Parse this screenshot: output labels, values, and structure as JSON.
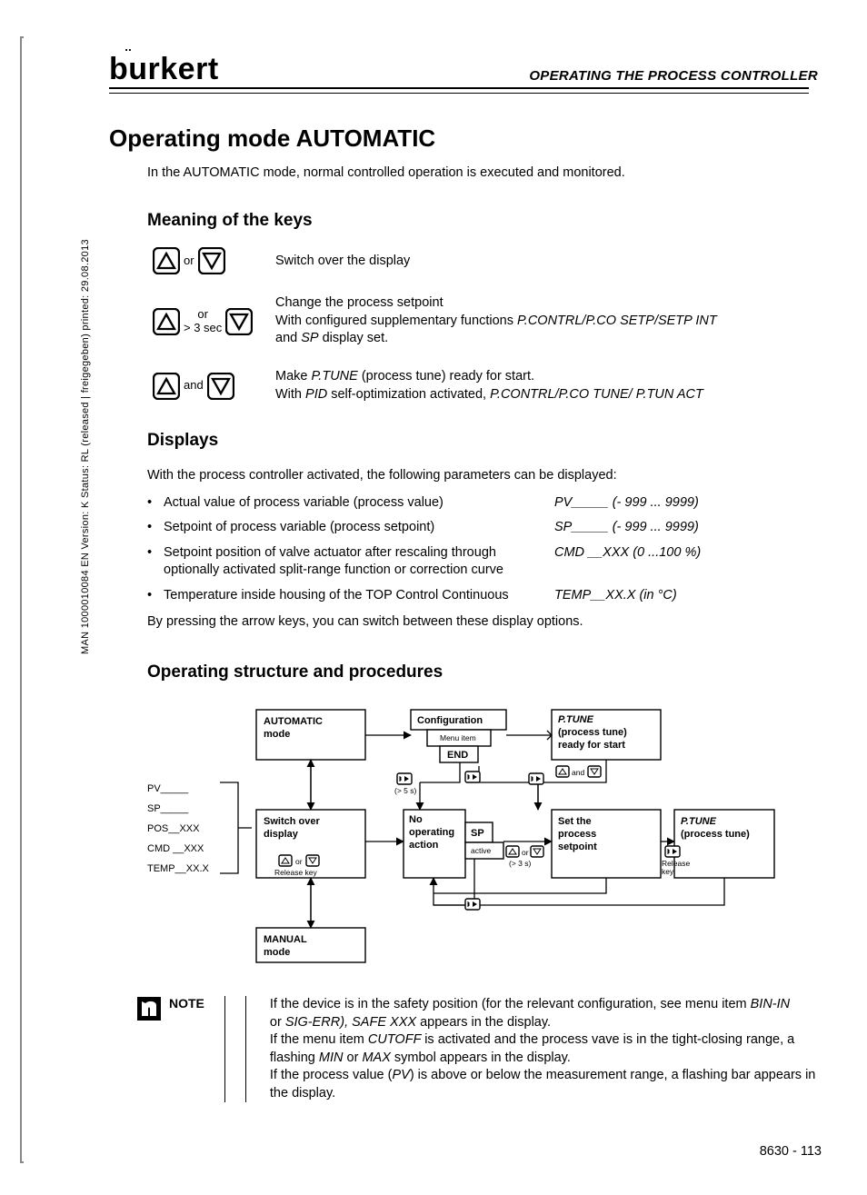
{
  "meta": {
    "side_text": "MAN 1000010084 EN Version: K Status: RL (released | freigegeben) printed: 29.08.2013"
  },
  "header": {
    "brand": "burkert",
    "section": "OPERATING THE PROCESS CONTROLLER"
  },
  "h1": "Operating mode AUTOMATIC",
  "intro": "In the AUTOMATIC mode, normal controlled operation is executed and monitored.",
  "keys_h": "Meaning of the keys",
  "keys": {
    "r1": {
      "between": "or",
      "desc": "Switch over the display"
    },
    "r2": {
      "between1": "or",
      "between2": "> 3 sec",
      "desc1": "Change the process setpoint",
      "desc2a": "With configured supplementary functions ",
      "desc2b": "P.CONTRL/P.CO SETP/SETP INT",
      "desc3a": "and ",
      "desc3b": "SP",
      "desc3c": " display set."
    },
    "r3": {
      "between": "and",
      "desc1a": "Make ",
      "desc1b": "P.TUNE",
      "desc1c": " (process tune) ready for start.",
      "desc2a": "With ",
      "desc2b": "PID",
      "desc2c": " self-optimization activated, ",
      "desc2d": "P.CONTRL/P.CO TUNE/ P.TUN ACT"
    }
  },
  "disp_h": "Displays",
  "disp_intro": "With the process controller activated, the following parameters can be displayed:",
  "disp_items": [
    {
      "left": "Actual value of process variable (process value)",
      "right": "PV_____  (- 999 ... 9999)"
    },
    {
      "left": "Setpoint of process variable (process setpoint)",
      "right": "SP_____  (- 999 ... 9999)"
    },
    {
      "left": "Setpoint position of valve actuator after rescaling through optionally activated split-range function or correction curve",
      "right": "CMD __XXX (0 ...100 %)"
    },
    {
      "left": "Temperature inside housing of the TOP Control Continuous",
      "right": "TEMP__XX.X  (in °C)"
    }
  ],
  "disp_tail": "By pressing the arrow keys, you can switch between these display options.",
  "struct_h": "Operating structure and procedures",
  "diagram": {
    "labels_left": {
      "a": "PV_____",
      "b": "SP_____",
      "c": "POS__XXX",
      "d": "CMD __XXX",
      "e": "TEMP__XX.X"
    },
    "b_auto1": "AUTOMATIC",
    "b_auto2": "mode",
    "b_cfg": "Configuration",
    "b_cfg2": "Menu item",
    "b_cfg3": "END",
    "b_ptr1": "P.TUNE",
    "b_ptr2": "(process tune)",
    "b_ptr3": "ready for start",
    "b_sw1": "Switch over",
    "b_sw2": "display",
    "b_no1": "No",
    "b_no2": "operating",
    "b_no3": "action",
    "b_sp": "SP",
    "b_spact": "active",
    "b_set1": "Set the",
    "b_set2": "process",
    "b_set3": "setpoint",
    "b_pt1": "P.TUNE",
    "b_pt2": "(process tune)",
    "b_man1": "MANUAL",
    "b_man2": "mode",
    "t_rel": "Release key",
    "t_rel2": "Release key",
    "t_5s": "(> 5 s)",
    "t_3s": "(> 3 s)",
    "t_or": "or",
    "t_and": "and"
  },
  "note": {
    "label": "NOTE",
    "p1a": "If the device is in the safety position (for the relevant configuration, see menu item ",
    "p1b": "BIN-IN",
    "p2a": "or ",
    "p2b": "SIG-ERR), SAFE XXX ",
    "p2c": " appears in the display.",
    "p3a": "If the menu item  ",
    "p3b": "CUTOFF ",
    "p3c": " is activated and the process vave is in the tight-closing range, a flashing ",
    "p3d": "MIN",
    "p3e": " or ",
    "p3f": "MAX",
    "p3g": " symbol appears in the display.",
    "p4a": "If the process value (",
    "p4b": "PV",
    "p4c": ") is above or below the measurement range, a flashing bar appears in the display."
  },
  "footer": "8630  -  113"
}
